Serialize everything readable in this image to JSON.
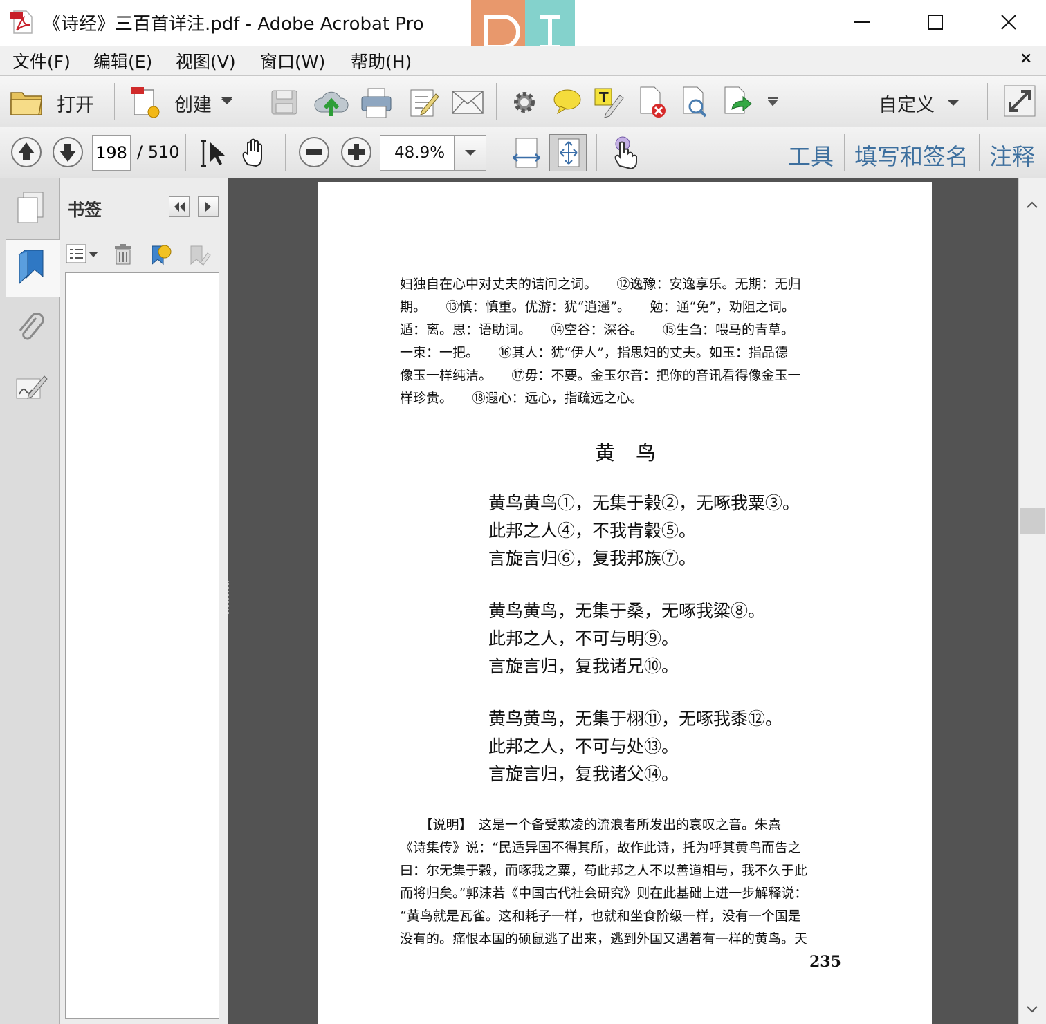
{
  "window": {
    "title": "《诗经》三百首详注.pdf - Adobe Acrobat Pro",
    "icon": "pdf-file-icon",
    "controls": [
      "minimize-icon",
      "maximize-icon",
      "close-icon"
    ]
  },
  "menu": {
    "items": [
      "文件(F)",
      "编辑(E)",
      "视图(V)",
      "窗口(W)",
      "帮助(H)"
    ],
    "close_glyph": "×"
  },
  "toolbar": {
    "open_label": "打开",
    "create_label": "创建",
    "customize_label": "自定义",
    "icons": [
      "folder-icon",
      "create-pdf-icon",
      "save-icon",
      "cloud-upload-icon",
      "print-icon",
      "edit-icon",
      "email-icon",
      "gear-icon",
      "comment-icon",
      "highlight-icon",
      "delete-page-icon",
      "search-page-icon",
      "export-icon",
      "expand-icon"
    ]
  },
  "navigation": {
    "current_page": "198",
    "total_pages": "/ 510",
    "zoom": "48.9%",
    "right_links": [
      "工具",
      "填写和签名",
      "注释"
    ]
  },
  "bookmarks": {
    "title": "书签"
  },
  "document": {
    "notes": [
      "妇独自在心中对丈夫的诘问之词。　　⑫逸豫：安逸享乐。无期：无归",
      "期。　　⑬慎：慎重。优游：犹“逍遥”。　　勉：通“免”，劝阻之词。",
      "遁：离。思：语助词。　　⑭空谷：深谷。　　⑮生刍：喂马的青草。",
      "一束：一把。　　⑯其人：犹“伊人”，指思妇的丈夫。如玉：指品德",
      "像玉一样纯洁。　　⑰毋：不要。金玉尔音：把你的音讯看得像金玉一",
      "样珍贵。　　⑱遐心：远心，指疏远之心。"
    ],
    "poem_title": "黄鸟",
    "poem": [
      "黄鸟黄鸟①，无集于榖②，无啄我粟③。",
      "此邦之人④，不我肯穀⑤。",
      "言旋言归⑥，复我邦族⑦。",
      "黄鸟黄鸟，无集于桑，无啄我粱⑧。",
      "此邦之人，不可与明⑨。",
      "言旋言归，复我诸兄⑩。",
      "黄鸟黄鸟，无集于栩⑪，无啄我黍⑫。",
      "此邦之人，不可与处⑬。",
      "言旋言归，复我诸父⑭。"
    ],
    "description": [
      "　　【说明】　这是一个备受欺凌的流浪者所发出的哀叹之音。朱熹",
      "《诗集传》说：“民适异国不得其所，故作此诗，托为呼其黄鸟而告之",
      "曰：尔无集于榖，而啄我之粟，苟此邦之人不以善道相与，我不久于此",
      "而将归矣。”郭沫若《中国古代社会研究》则在此基础上进一步解释说：",
      "“黄鸟就是瓦雀。这和耗子一样，也就和坐食阶级一样，没有一个国是",
      "没有的。痛恨本国的硕鼠逃了出来，逃到外国又遇着有一样的黄鸟。天"
    ],
    "page_number": "235"
  },
  "colors": {
    "link_blue": "#3d6f9e",
    "doc_background": "#535353"
  }
}
